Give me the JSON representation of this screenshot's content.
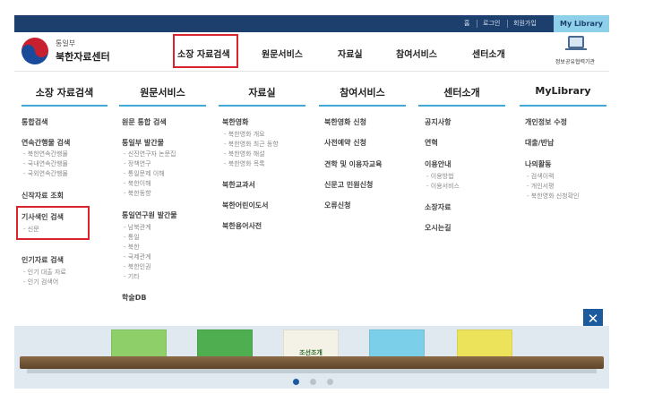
{
  "topbar": {
    "home": "홈",
    "login": "로그인",
    "join": "회원가입",
    "my_library": "My Library"
  },
  "header": {
    "ministry": "통일부",
    "center_name": "북한자료센터",
    "portal_label": "정보공유협력기관"
  },
  "gnb": [
    "소장 자료검색",
    "원문서비스",
    "자료실",
    "참여서비스",
    "센터소개"
  ],
  "menu": {
    "col1": {
      "title": "소장 자료검색",
      "items": [
        "통합검색",
        "연속간행물 검색",
        "신작자료 조회",
        "기사색인 검색",
        "인기자료 검색"
      ],
      "sub_periodicals": [
        "- 북한연속간행물",
        "- 국내연속간행물",
        "- 국외연속간행물"
      ],
      "sub_article": [
        "- 신문"
      ],
      "sub_popular": [
        "- 인기 대출 자료",
        "- 인기 검색어"
      ]
    },
    "col2": {
      "title": "원문서비스",
      "items": [
        "원문 통합 검색",
        "통일부 발간물",
        "통일연구원 발간물",
        "학술DB"
      ],
      "sub_ministry": [
        "- 신진연구자 논문집",
        "- 정책연구",
        "- 통일문제 이해",
        "- 북한이해",
        "- 북한동향"
      ],
      "sub_institute": [
        "- 남북관계",
        "- 통일",
        "- 북한",
        "- 국제관계",
        "- 북한인권",
        "- 기타"
      ]
    },
    "col3": {
      "title": "자료실",
      "items": [
        "북한영화",
        "북한교과서",
        "북한어린이도서",
        "북한용어사전"
      ],
      "sub_film": [
        "- 북한영화 개요",
        "- 북한영화 최근 동향",
        "- 북한영화 해설",
        "- 북한영화 목록"
      ]
    },
    "col4": {
      "title": "참여서비스",
      "items": [
        "북한영화 신청",
        "사전예약 신청",
        "견학 및 이용자교육",
        "신문고 민원신청",
        "오류신청"
      ]
    },
    "col5": {
      "title": "센터소개",
      "items": [
        "공지사항",
        "연혁",
        "이용안내",
        "소장자료",
        "오시는길"
      ],
      "sub_guide": [
        "- 이용방법",
        "- 이용서비스"
      ]
    },
    "col6": {
      "title": "MyLibrary",
      "items": [
        "개인정보 수정",
        "대출/반납",
        "나의활동"
      ],
      "sub_activity": [
        "- 검색이력",
        "- 개인서평",
        "- 북한영화 신청확인"
      ]
    }
  },
  "shelf": {
    "book_title": "조선조개",
    "books": [
      {
        "color": "#8fcf6a"
      },
      {
        "color": "#4fae4f"
      },
      {
        "color": "#f4f1e6"
      },
      {
        "color": "#7ccfe8"
      },
      {
        "color": "#ece35a"
      }
    ],
    "pages": 3,
    "active_page": 1
  },
  "colors": {
    "topbar": "#1c3f6e",
    "accent_line": "#3ea8d6",
    "highlight_box": "#d9232d",
    "close_button": "#1c5a9e"
  }
}
